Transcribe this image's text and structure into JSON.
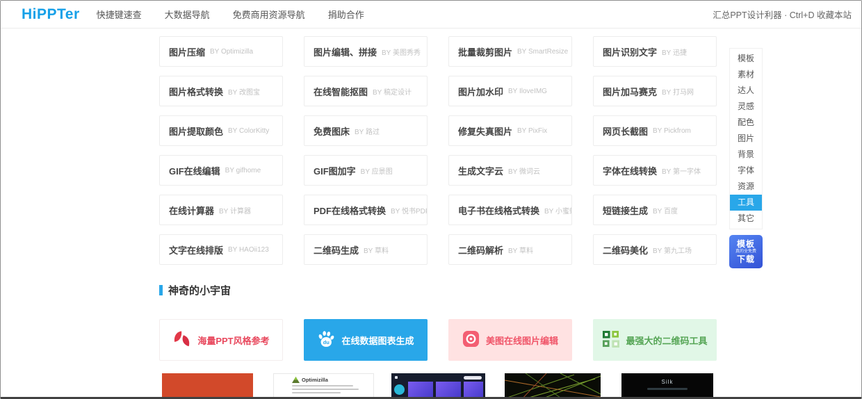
{
  "header": {
    "logo": "HiPPTer",
    "nav": [
      "快捷键速查",
      "大数据导航",
      "免费商用资源导航",
      "捐助合作"
    ],
    "right_note": "汇总PPT设计利器 · Ctrl+D 收藏本站"
  },
  "tools": {
    "by_prefix": "BY",
    "items": [
      {
        "name": "图片压缩",
        "by": "Optimizilla"
      },
      {
        "name": "图片编辑、拼接",
        "by": "美图秀秀"
      },
      {
        "name": "批量裁剪图片",
        "by": "SmartResize"
      },
      {
        "name": "图片识别文字",
        "by": "迅捷"
      },
      {
        "name": "图片格式转换",
        "by": "改图宝"
      },
      {
        "name": "在线智能抠图",
        "by": "稿定设计"
      },
      {
        "name": "图片加水印",
        "by": "IloveIMG"
      },
      {
        "name": "图片加马赛克",
        "by": "打马网"
      },
      {
        "name": "图片提取颜色",
        "by": "ColorKitty"
      },
      {
        "name": "免费图床",
        "by": "路过"
      },
      {
        "name": "修复失真图片",
        "by": "PixFix"
      },
      {
        "name": "网页长截图",
        "by": "Pickfrom"
      },
      {
        "name": "GIF在线编辑",
        "by": "gifhome"
      },
      {
        "name": "GIF图加字",
        "by": "应景图"
      },
      {
        "name": "生成文字云",
        "by": "微词云"
      },
      {
        "name": "字体在线转换",
        "by": "第一字体"
      },
      {
        "name": "在线计算器",
        "by": "计算器"
      },
      {
        "name": "PDF在线格式转换",
        "by": "悦书PDF"
      },
      {
        "name": "电子书在线格式转换",
        "by": "小蜜蜂"
      },
      {
        "name": "短链接生成",
        "by": "百度"
      },
      {
        "name": "文字在线排版",
        "by": "HAOii123"
      },
      {
        "name": "二维码生成",
        "by": "草料"
      },
      {
        "name": "二维码解析",
        "by": "草料"
      },
      {
        "name": "二维码美化",
        "by": "第九工场"
      }
    ]
  },
  "sidebar": {
    "items": [
      {
        "label": "模板",
        "active": false
      },
      {
        "label": "素材",
        "active": false
      },
      {
        "label": "达人",
        "active": false
      },
      {
        "label": "灵感",
        "active": false
      },
      {
        "label": "配色",
        "active": false
      },
      {
        "label": "图片",
        "active": false
      },
      {
        "label": "背景",
        "active": false
      },
      {
        "label": "字体",
        "active": false
      },
      {
        "label": "资源",
        "active": false
      },
      {
        "label": "工具",
        "active": true
      },
      {
        "label": "其它",
        "active": false
      }
    ],
    "badge": {
      "line1": "模板",
      "line2": "真的全免费",
      "line3": "下载"
    }
  },
  "section": {
    "title": "神奇的小宇宙"
  },
  "features": [
    {
      "label": "海量PPT风格参考",
      "icon": "petal-logo-icon",
      "bg": "#ffffff",
      "color": "#e8495e"
    },
    {
      "label": "在线数据图表生成",
      "icon": "baidu-paw-icon",
      "bg": "#29a7e9",
      "color": "#ffffff"
    },
    {
      "label": "美图在线图片编辑",
      "icon": "meitu-camera-icon",
      "bg": "#ffe2e2",
      "color": "#f0566a"
    },
    {
      "label": "最强大的二维码工具",
      "icon": "qrcode-icon",
      "bg": "#e1f7e7",
      "color": "#55a555"
    }
  ],
  "thumbnails": [
    {
      "name": "orange-cover-thumbnail",
      "label": ""
    },
    {
      "name": "optimizilla-site-thumbnail",
      "label": "Optimizilla"
    },
    {
      "name": "purple-gallery-site-thumbnail",
      "label": ""
    },
    {
      "name": "light-streaks-art-thumbnail",
      "label": ""
    },
    {
      "name": "silk-site-thumbnail",
      "label": "Silk"
    }
  ],
  "colors": {
    "accent_blue": "#29a7e9",
    "logo_blue": "#16a0e8",
    "badge_blue_top": "#5585f2",
    "badge_blue_bottom": "#3352d6"
  }
}
